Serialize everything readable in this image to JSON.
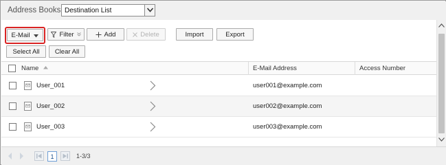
{
  "header": {
    "title": "Address Books",
    "book_select": {
      "value": "Destination List"
    }
  },
  "toolbar": {
    "type_dropdown": "E-Mail",
    "filter": "Filter",
    "add": "Add",
    "delete": "Delete",
    "import": "Import",
    "export": "Export",
    "select_all": "Select All",
    "clear_all": "Clear All"
  },
  "table": {
    "columns": [
      "Name",
      "E-Mail Address",
      "Access Number"
    ],
    "rows": [
      {
        "name": "User_001",
        "email": "user001@example.com",
        "access_number": ""
      },
      {
        "name": "User_002",
        "email": "user002@example.com",
        "access_number": ""
      },
      {
        "name": "User_003",
        "email": "user003@example.com",
        "access_number": ""
      }
    ]
  },
  "pagination": {
    "current_page": "1",
    "range": "1-3/3"
  },
  "colors": {
    "highlight": "#d92323",
    "page_border": "#6f9fd6"
  },
  "icons": [
    "chevron-down-icon",
    "filter-icon",
    "plus-icon",
    "x-icon",
    "sort-up-icon",
    "contact-card-icon",
    "chevron-right-icon",
    "scroll-up-icon",
    "scroll-down-icon",
    "first-page-icon",
    "last-page-icon",
    "prev-icon",
    "next-icon"
  ]
}
